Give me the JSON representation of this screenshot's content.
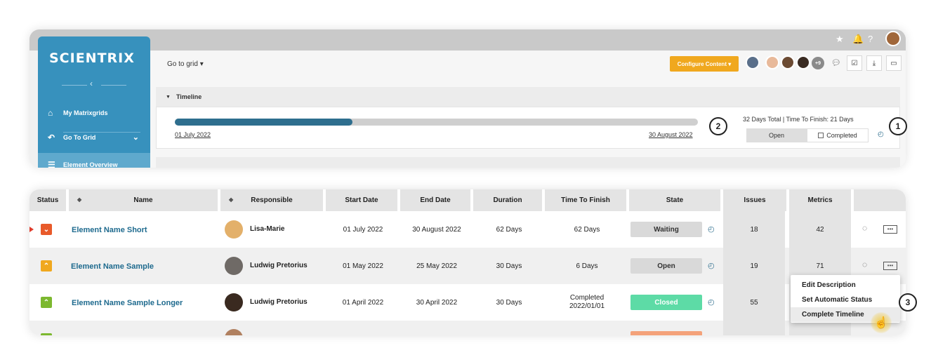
{
  "app": {
    "logo": "SCIENTRIX",
    "sidebar": [
      {
        "label": "My Matrixgrids",
        "icon": "home-icon"
      },
      {
        "label": "Go To Grid",
        "icon": "back-arrow-icon"
      },
      {
        "label": "Element Overview",
        "icon": "list-icon"
      }
    ],
    "goto_grid": "Go to grid ▾",
    "configure": "Configure Content ▾",
    "plus_count": "+9"
  },
  "timeline": {
    "header": "Timeline",
    "progress": 0.34,
    "start": "01 July 2022",
    "end": "30 August 2022",
    "summary": "32 Days Total  |  Time To Finish: 21 Days",
    "open_label": "Open",
    "completed_label": "Completed"
  },
  "callouts": [
    "1",
    "2",
    "3"
  ],
  "table": {
    "headers": [
      "Status",
      "Name",
      "Responsible",
      "Start Date",
      "End Date",
      "Duration",
      "Time To Finish",
      "State",
      "Issues",
      "Metrics"
    ],
    "rows": [
      {
        "name": "Element Name Short",
        "responsible": "Lisa-Marie",
        "start": "01 July 2022",
        "end": "30 August 2022",
        "duration": "62 Days",
        "ttf": "62 Days",
        "state": "Waiting",
        "issues": "18",
        "metrics": "42",
        "status_color": "#e85a2a",
        "state_color": "#d9d9d9"
      },
      {
        "name": "Element Name Sample",
        "responsible": "Ludwig Pretorius",
        "start": "01 May 2022",
        "end": "25 May 2022",
        "duration": "30 Days",
        "ttf": "6 Days",
        "state": "Open",
        "issues": "19",
        "metrics": "71",
        "status_color": "#f0a81e",
        "state_color": "#d9d9d9"
      },
      {
        "name": "Element Name Sample Longer",
        "responsible": "Ludwig Pretorius",
        "start": "01 April 2022",
        "end": "30 April 2022",
        "duration": "30 Days",
        "ttf": "Completed\n2022/01/01",
        "state": "Closed",
        "issues": "55",
        "metrics": "",
        "status_color": "#7cb82f",
        "state_color": "#5ddba6"
      }
    ]
  },
  "context_menu": [
    "Edit Description",
    "Set Automatic Status",
    "Complete Timeline"
  ]
}
